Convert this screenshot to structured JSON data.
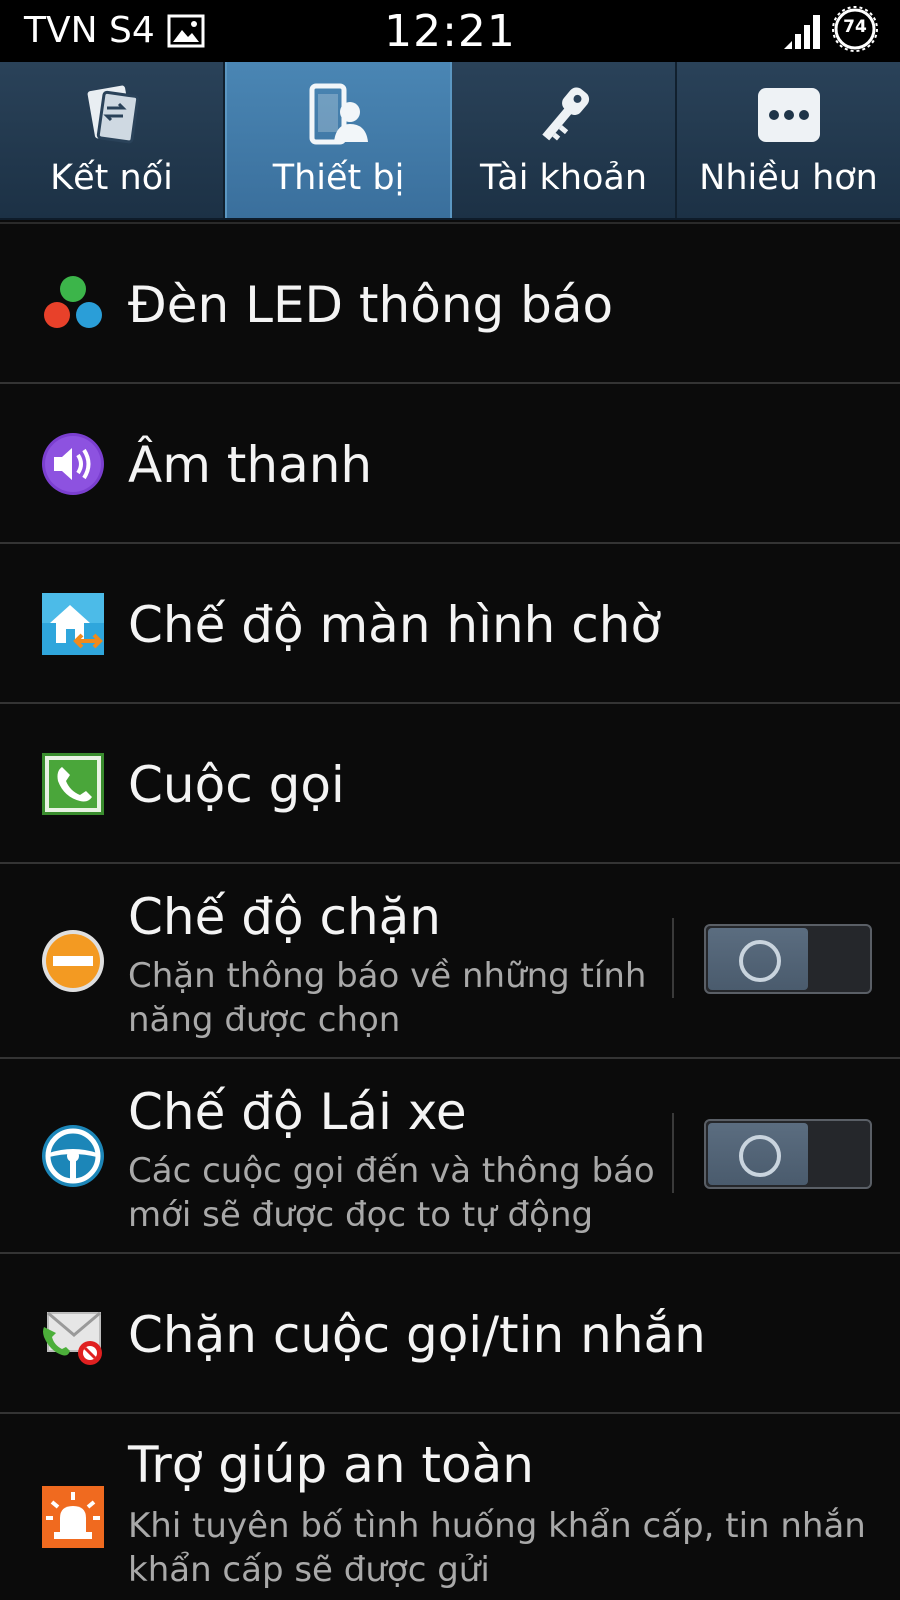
{
  "status_bar": {
    "carrier": "TVN S4",
    "time": "12:21",
    "battery": "74"
  },
  "tabs": [
    {
      "label": "Kết nối",
      "icon": "connections-icon",
      "active": false
    },
    {
      "label": "Thiết bị",
      "icon": "device-icon",
      "active": true
    },
    {
      "label": "Tài khoản",
      "icon": "accounts-key-icon",
      "active": false
    },
    {
      "label": "Nhiều hơn",
      "icon": "more-dots-icon",
      "active": false
    }
  ],
  "settings": [
    {
      "title": "Đèn LED thông báo",
      "icon": "led-indicator-icon"
    },
    {
      "title": "Âm thanh",
      "icon": "sound-icon"
    },
    {
      "title": "Chế độ màn hình chờ",
      "icon": "home-screen-mode-icon"
    },
    {
      "title": "Cuộc gọi",
      "icon": "call-icon"
    },
    {
      "title": "Chế độ chặn",
      "subtitle": "Chặn thông báo về những tính năng được chọn",
      "icon": "blocking-mode-icon",
      "toggle": "off"
    },
    {
      "title": "Chế độ Lái xe",
      "subtitle": "Các cuộc gọi đến và thông báo mới sẽ được đọc to tự động",
      "icon": "driving-mode-icon",
      "toggle": "off"
    },
    {
      "title": "Chặn cuộc gọi/tin nhắn",
      "icon": "call-message-block-icon"
    },
    {
      "title": "Trợ giúp an toàn",
      "subtitle": "Khi tuyên bố tình huống khẩn cấp, tin nhắn khẩn cấp sẽ được gửi",
      "icon": "safety-assistance-icon"
    }
  ],
  "colors": {
    "tab_bar": "#1f3549",
    "tab_active": "#4179a7",
    "background": "#0b0b0b",
    "subtitle_text": "#a9a9a9"
  }
}
